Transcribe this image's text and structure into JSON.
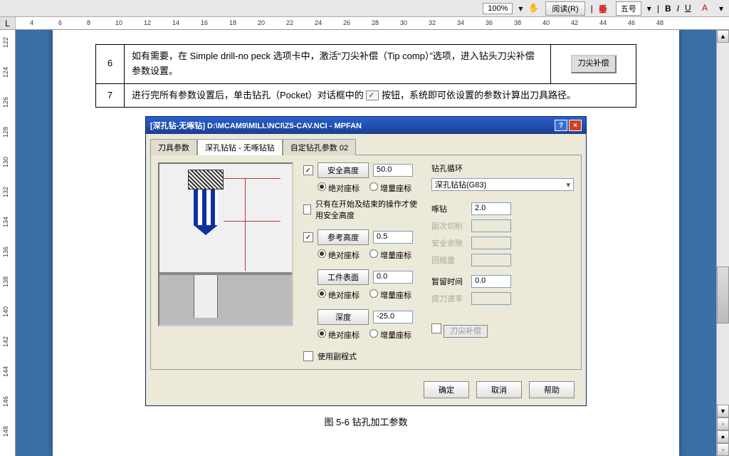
{
  "toolbar": {
    "zoom": "100%",
    "read": "阅读(R)",
    "fontsize_label": "五号",
    "bold": "B",
    "italic": "I"
  },
  "ruler_h": [
    "4",
    "6",
    "8",
    "10",
    "12",
    "14",
    "16",
    "18",
    "20",
    "22",
    "24",
    "26",
    "28",
    "30",
    "32",
    "34",
    "36",
    "38",
    "40",
    "42",
    "44",
    "46",
    "48"
  ],
  "ruler_v": [
    "122",
    "124",
    "126",
    "128",
    "130",
    "132",
    "134",
    "136",
    "138",
    "140",
    "142",
    "144",
    "146",
    "148"
  ],
  "table": {
    "row6": {
      "num": "6",
      "text": "如有需要，在 Simple drill-no peck 选项卡中，激活“刀尖补偿（Tip comp）”选项，进入钻头刀尖补偿参数设置。",
      "btn": "刀尖补偿"
    },
    "row7": {
      "num": "7",
      "text_a": "进行完所有参数设置后，单击钻孔（Pocket）对话框中的",
      "text_b": "按钮，系统即可依设置的参数计算出刀具路径。"
    }
  },
  "dialog": {
    "title": "[深孔钻-无啄钻]   D:\\MCAM9\\MILL\\NCI\\Z5-CAV.NCI - MPFAN",
    "tabs": [
      "刀具参数",
      "深孔钻钻 - 无啄钻钻",
      "自定钻孔参数 02"
    ],
    "params": {
      "safe_z": {
        "label": "安全高度",
        "value": "50.0"
      },
      "radio_abs": "绝对座标",
      "radio_inc": "增量座标",
      "only_start_end": "只有在开始及结束的操作才使用安全高度",
      "ref_z": {
        "label": "参考高度",
        "value": "0.5"
      },
      "work_z": {
        "label": "工件表面",
        "value": "0.0"
      },
      "depth": {
        "label": "深度",
        "value": "-25.0"
      },
      "use_sub": "使用副程式"
    },
    "cycle": {
      "label": "钻孔循环",
      "value": "深孔钻钻(G83)",
      "peck": {
        "label": "啄钻",
        "value": "2.0"
      },
      "dwell": {
        "label": "暂留时间",
        "value": "0.0"
      }
    },
    "buttons": {
      "ok": "确定",
      "cancel": "取消",
      "help": "帮助"
    }
  },
  "caption": "图 5-6  钻孔加工参数"
}
